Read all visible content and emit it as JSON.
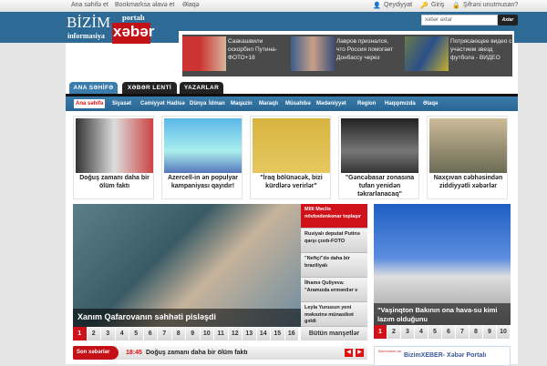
{
  "topbar": {
    "links": [
      "Ana səhifə et",
      "Bookmarksa əlavə et",
      "Əlaqə"
    ],
    "register": "Qeydiyyat",
    "login": "Giriş",
    "forgot": "Şifrəni unutmusan?"
  },
  "logo": {
    "line1": "BİZİM",
    "line2": "informasiya",
    "portal": "portalı",
    "brand": "xəbər"
  },
  "search": {
    "placeholder": "xəbər axtar",
    "button": "Axtar"
  },
  "ads": [
    {
      "text": "Саакашвили оскорбил Путина-ФОТО+18"
    },
    {
      "text": "Лавров признался, что Россия помогает Донбассу через"
    },
    {
      "text": "Потрясающее видео с участием звезд футбола - ВИДЕО"
    }
  ],
  "tabs": [
    "ANA SƏHİFƏ",
    "XƏBƏR LENTİ",
    "YAZARLAR"
  ],
  "categories": [
    "Ana səhifə",
    "Siyasət",
    "Cəmiyyət",
    "Hadisə",
    "Dünya",
    "İdman",
    "Maqazin",
    "Maraqlı",
    "Müsahibə",
    "Mədəniyyət",
    "Region",
    "Haqqımızda",
    "Əlaqə"
  ],
  "cards": [
    "Doğuş zamanı daha bir ölüm faktı",
    "Azercell-in ən populyar kampaniyası qayıdır!",
    "\"İraq bölünəcək, bizi kürdlərə verirlər\"",
    "\"Gəncəbasar zonasına tufan yenidən təkrarlanacaq\"",
    "Naxçıvan cəbhəsindən ziddiyyətli xəbərlər"
  ],
  "slider": {
    "caption": "Xanım Qafarovanın səhhəti pisləşdi",
    "side": [
      "Milli Məclis növbədənkənar toplaşır",
      "Rusiyalı deputat Putinə qarşı çıxdı-FOTO",
      "\"Neftçi\"də daha bir braziliyalı",
      "İlhamə Quliyeva: \"Aramızda ermənilər v",
      "Leyla Yunusun yeni məkəzinə münasibət gəldi"
    ],
    "pages": [
      "1",
      "2",
      "3",
      "4",
      "5",
      "6",
      "7",
      "8",
      "9",
      "10",
      "11",
      "12",
      "13",
      "14",
      "15",
      "16"
    ],
    "all": "Bütün manşetlər"
  },
  "son": {
    "label": "Son xəbərlər",
    "time": "18:45",
    "text": "Doğuş zamanı daha bir ölüm faktı"
  },
  "rslider": {
    "caption": "\"Vaşinqton Bakının ona hava-su kimi lazım olduğunu",
    "pages": [
      "1",
      "2",
      "3",
      "4",
      "5",
      "6",
      "7",
      "8",
      "9",
      "10"
    ]
  },
  "fb": {
    "title": "BizimXEBER- Xəbər Portalı",
    "logo": "Bizimxeber.az"
  }
}
